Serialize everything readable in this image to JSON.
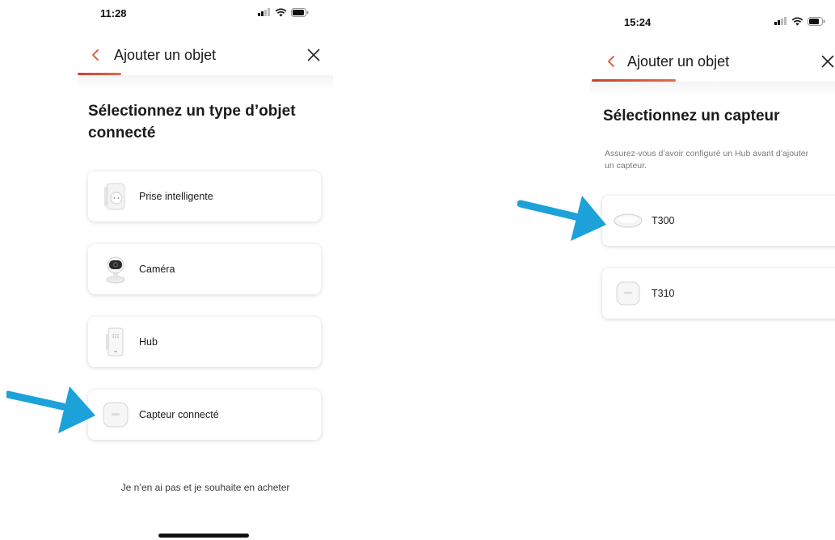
{
  "left_screen": {
    "status_time": "11:28",
    "nav": {
      "title": "Ajouter un objet"
    },
    "heading_line1": "Sélectionnez un type d’objet",
    "heading_line2": "connecté",
    "items": [
      {
        "label": "Prise intelligente",
        "icon": "smart-plug-icon"
      },
      {
        "label": "Caméra",
        "icon": "camera-icon"
      },
      {
        "label": "Hub",
        "icon": "hub-icon"
      },
      {
        "label": "Capteur connecté",
        "icon": "sensor-icon"
      }
    ],
    "buy_link": "Je n’en ai pas et je souhaite en acheter"
  },
  "right_screen": {
    "status_time": "15:24",
    "nav": {
      "title": "Ajouter un objet"
    },
    "heading": "Sélectionnez un capteur",
    "subtitle_line1": "Assurez-vous d’avoir configuré un Hub avant d’ajouter",
    "subtitle_line2": "un capteur.",
    "items": [
      {
        "label": "T300",
        "icon": "water-leak-sensor-icon"
      },
      {
        "label": "T310",
        "icon": "temperature-sensor-icon"
      }
    ]
  },
  "colors": {
    "accent": "#d9512f",
    "arrow": "#1da1d9",
    "card_shadow": "rgba(0,0,0,0.16)"
  }
}
